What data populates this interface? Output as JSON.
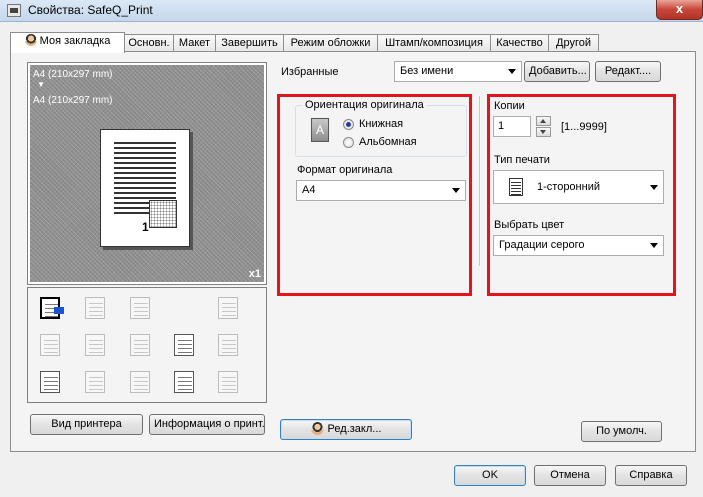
{
  "window": {
    "title": "Свойства: SafeQ_Print",
    "close_label": "x"
  },
  "tabs": [
    {
      "label": "Моя закладка",
      "active": true
    },
    {
      "label": "Основн."
    },
    {
      "label": "Макет"
    },
    {
      "label": "Завершить"
    },
    {
      "label": "Режим обложки"
    },
    {
      "label": "Штамп/композиция"
    },
    {
      "label": "Качество"
    },
    {
      "label": "Другой"
    }
  ],
  "preview": {
    "original_size": "A4 (210x297 mm)",
    "output_size": "A4 (210x297 mm)",
    "page_number": "1",
    "copies_badge": "x1",
    "arrow": "▼"
  },
  "left_buttons": {
    "printer_view": "Вид принтера",
    "printer_info": "Информация о принт."
  },
  "favorites": {
    "label": "Избранные",
    "value": "Без имени",
    "add_button": "Добавить...",
    "edit_button": "Редакт...."
  },
  "orientation": {
    "group_label": "Ориентация оригинала",
    "icon_letter": "A",
    "portrait_label": "Книжная",
    "landscape_label": "Альбомная",
    "selected": "portrait"
  },
  "paper_format": {
    "label": "Формат оригинала",
    "value": "A4"
  },
  "copies": {
    "label": "Копии",
    "value": "1",
    "range": "[1...9999]"
  },
  "print_type": {
    "label": "Тип печати",
    "value": "1-сторонний"
  },
  "color": {
    "label": "Выбрать цвет",
    "value": "Градации серого"
  },
  "footer": {
    "edit_tab_button": "Ред.закл...",
    "defaults_button": "По умолч.",
    "ok_button": "OK",
    "cancel_button": "Отмена",
    "help_button": "Справка"
  },
  "colors": {
    "highlight_box": "#e3141c",
    "title_bar": "#c5d7ec",
    "close_button": "#c7463a"
  }
}
